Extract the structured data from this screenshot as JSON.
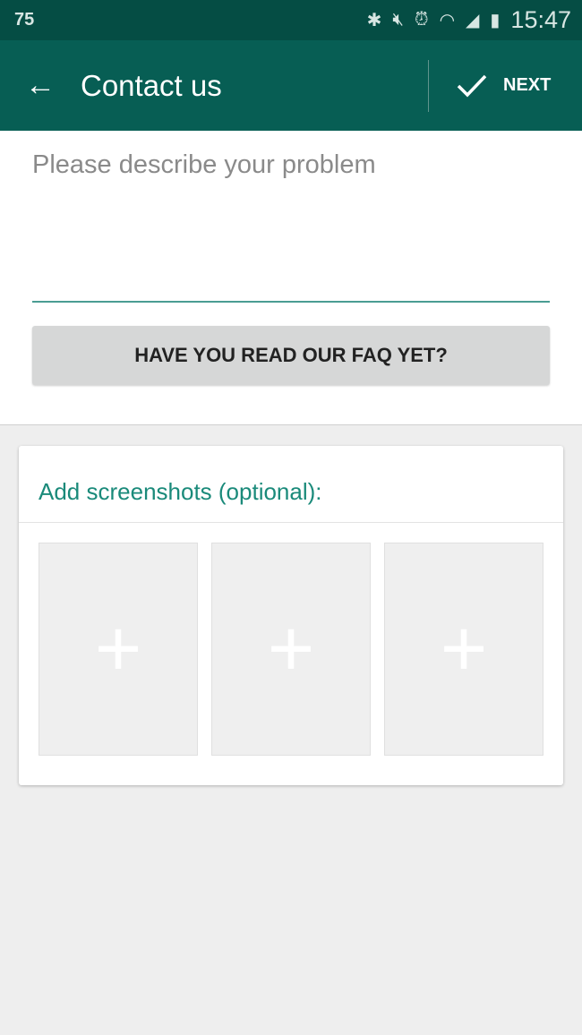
{
  "status_bar": {
    "left_number": "75",
    "time": "15:47",
    "icons": [
      "bluetooth-icon",
      "vibrate-mute-icon",
      "alarm-icon",
      "wifi-icon",
      "signal-icon",
      "battery-icon"
    ]
  },
  "toolbar": {
    "title": "Contact us",
    "next_label": "NEXT"
  },
  "form": {
    "problem_placeholder": "Please describe your problem",
    "problem_value": "",
    "faq_button": "HAVE YOU READ OUR FAQ YET?"
  },
  "screenshots": {
    "title": "Add screenshots (optional):",
    "slots": [
      "+",
      "+",
      "+"
    ]
  },
  "colors": {
    "toolbar": "#075e54",
    "status_bar": "#054d44",
    "accent": "#1a8a7a"
  }
}
